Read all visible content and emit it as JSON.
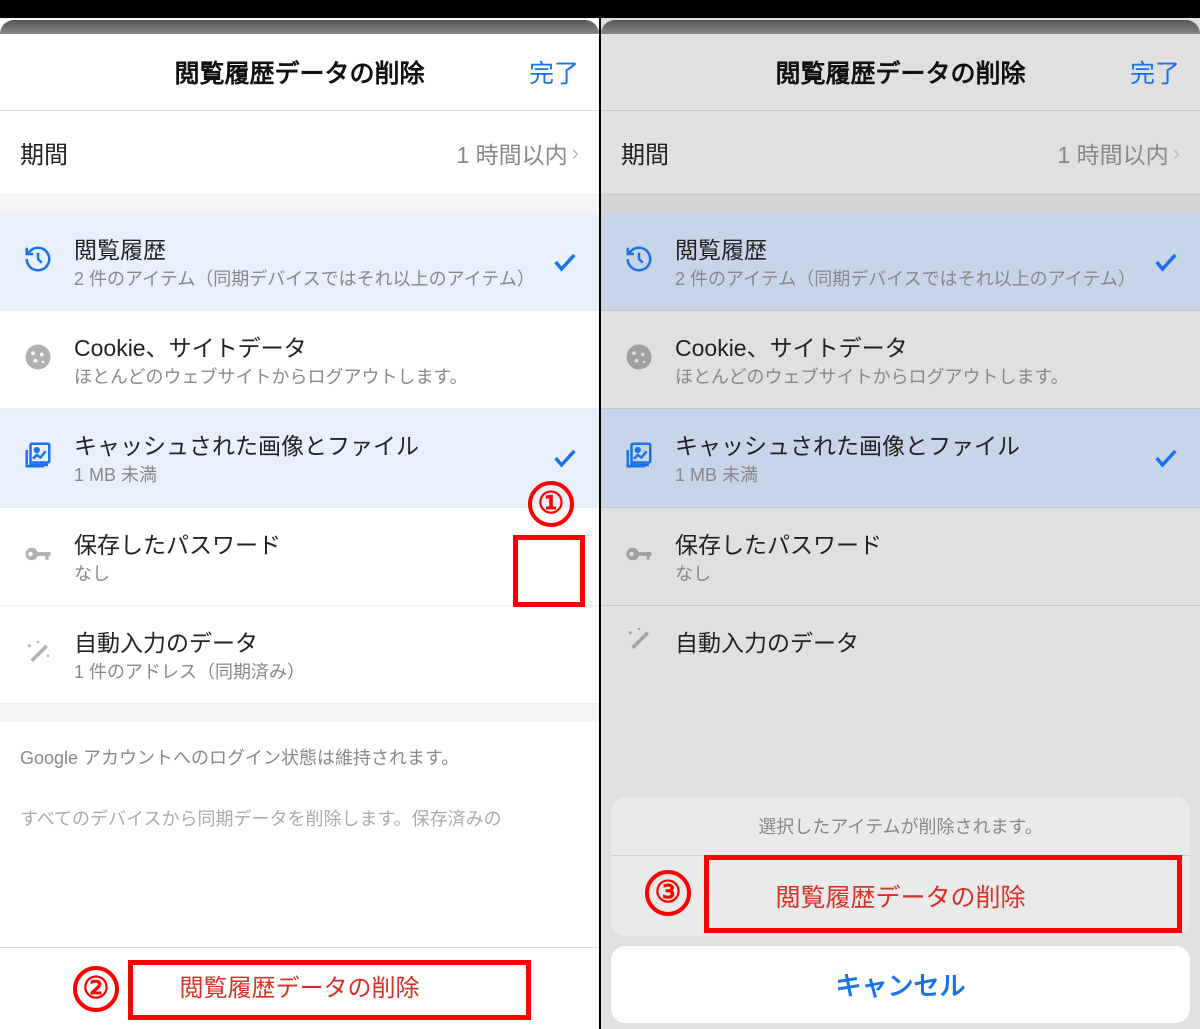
{
  "left": {
    "header": {
      "title": "閲覧履歴データの削除",
      "done": "完了"
    },
    "time": {
      "label": "期間",
      "value": "1 時間以内"
    },
    "items": [
      {
        "title": "閲覧履歴",
        "sub": "2 件のアイテム（同期デバイスではそれ以上のアイテム）"
      },
      {
        "title": "Cookie、サイトデータ",
        "sub": "ほとんどのウェブサイトからログアウトします。"
      },
      {
        "title": "キャッシュされた画像とファイル",
        "sub": "1 MB 未満"
      },
      {
        "title": "保存したパスワード",
        "sub": "なし"
      },
      {
        "title": "自動入力のデータ",
        "sub": "1 件のアドレス（同期済み）"
      }
    ],
    "note1": "Google アカウントへのログイン状態は維持されます。",
    "note2": "すべてのデバイスから同期データを削除します。保存済みの",
    "clearBtn": "閲覧履歴データの削除",
    "anno": {
      "n1": "①",
      "n2": "②"
    }
  },
  "right": {
    "header": {
      "title": "閲覧履歴データの削除",
      "done": "完了"
    },
    "time": {
      "label": "期間",
      "value": "1 時間以内"
    },
    "items": [
      {
        "title": "閲覧履歴",
        "sub": "2 件のアイテム（同期デバイスではそれ以上のアイテム）"
      },
      {
        "title": "Cookie、サイトデータ",
        "sub": "ほとんどのウェブサイトからログアウトします。"
      },
      {
        "title": "キャッシュされた画像とファイル",
        "sub": "1 MB 未満"
      },
      {
        "title": "保存したパスワード",
        "sub": "なし"
      },
      {
        "title": "自動入力のデータ",
        "sub": ""
      }
    ],
    "sheet": {
      "title": "選択したアイテムが削除されます。",
      "action": "閲覧履歴データの削除",
      "cancel": "キャンセル"
    },
    "anno": {
      "n3": "③"
    }
  }
}
